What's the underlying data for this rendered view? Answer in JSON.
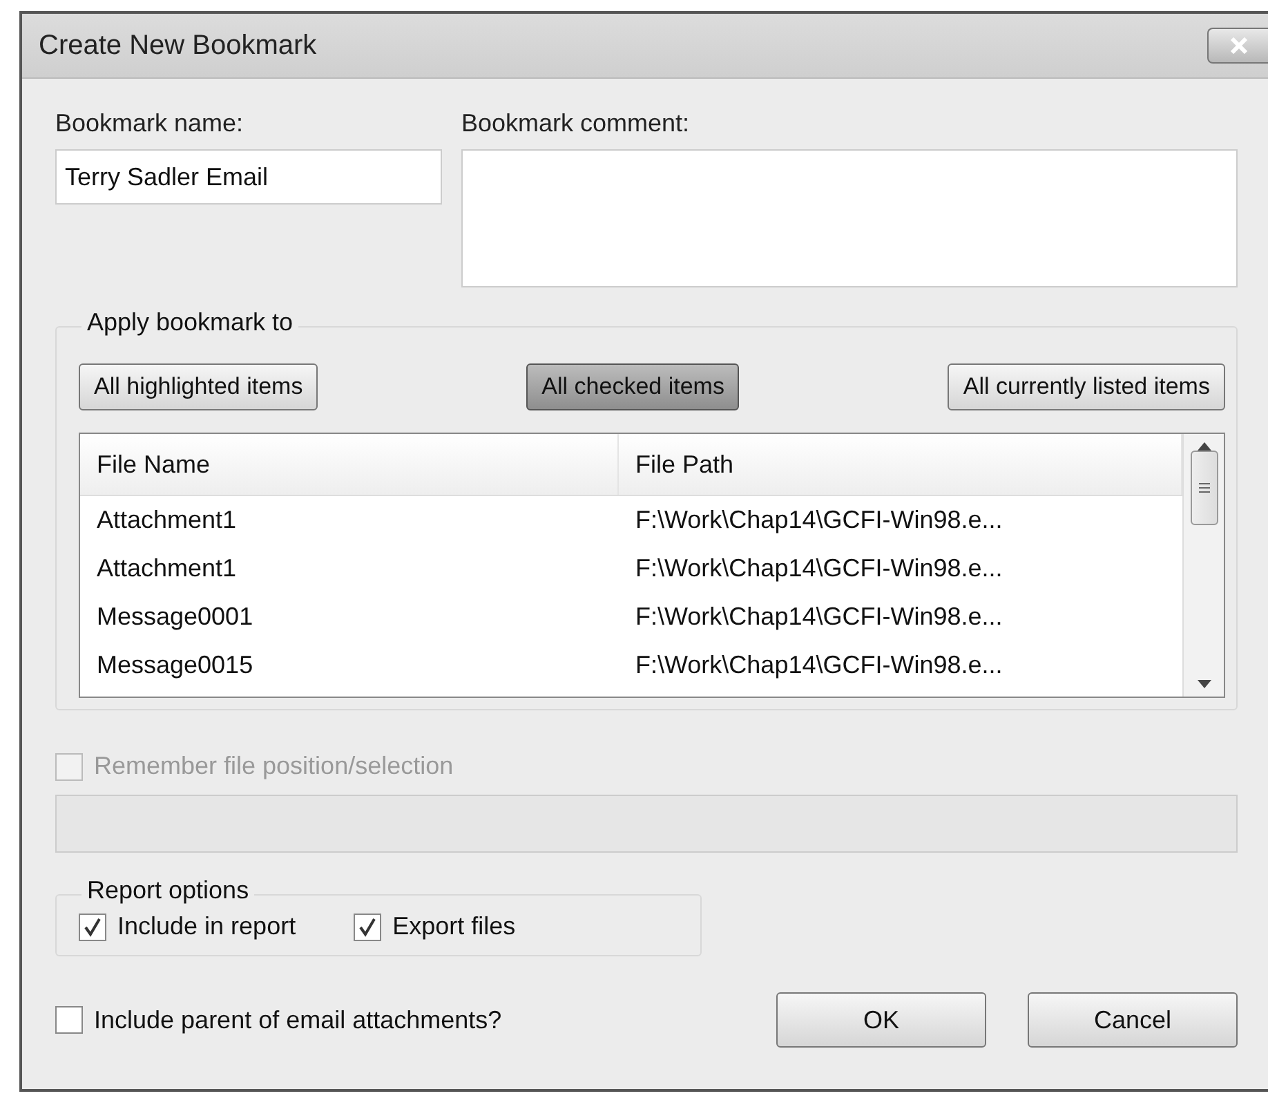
{
  "window": {
    "title": "Create New Bookmark"
  },
  "name_field": {
    "label": "Bookmark name:",
    "value": "Terry Sadler Email"
  },
  "comment_field": {
    "label": "Bookmark comment:"
  },
  "apply_group": {
    "title": "Apply bookmark to",
    "buttons": [
      {
        "label": "All highlighted items",
        "selected": false
      },
      {
        "label": "All checked items",
        "selected": true
      },
      {
        "label": "All currently listed items",
        "selected": false
      }
    ],
    "table": {
      "columns": [
        "File Name",
        "File Path"
      ],
      "rows": [
        [
          "Attachment1",
          "F:\\Work\\Chap14\\GCFI-Win98.e..."
        ],
        [
          "Attachment1",
          "F:\\Work\\Chap14\\GCFI-Win98.e..."
        ],
        [
          "Message0001",
          "F:\\Work\\Chap14\\GCFI-Win98.e..."
        ],
        [
          "Message0015",
          "F:\\Work\\Chap14\\GCFI-Win98.e..."
        ]
      ]
    }
  },
  "remember": {
    "label": "Remember file position/selection",
    "checked": false,
    "disabled": true
  },
  "remember_field": {
    "disabled": true
  },
  "report_options": {
    "title": "Report options",
    "options": [
      {
        "label": "Include in report",
        "checked": true
      },
      {
        "label": "Export files",
        "checked": true
      }
    ]
  },
  "include_parent": {
    "label": "Include parent of email attachments?",
    "checked": false
  },
  "buttons": [
    "OK",
    "Cancel"
  ]
}
